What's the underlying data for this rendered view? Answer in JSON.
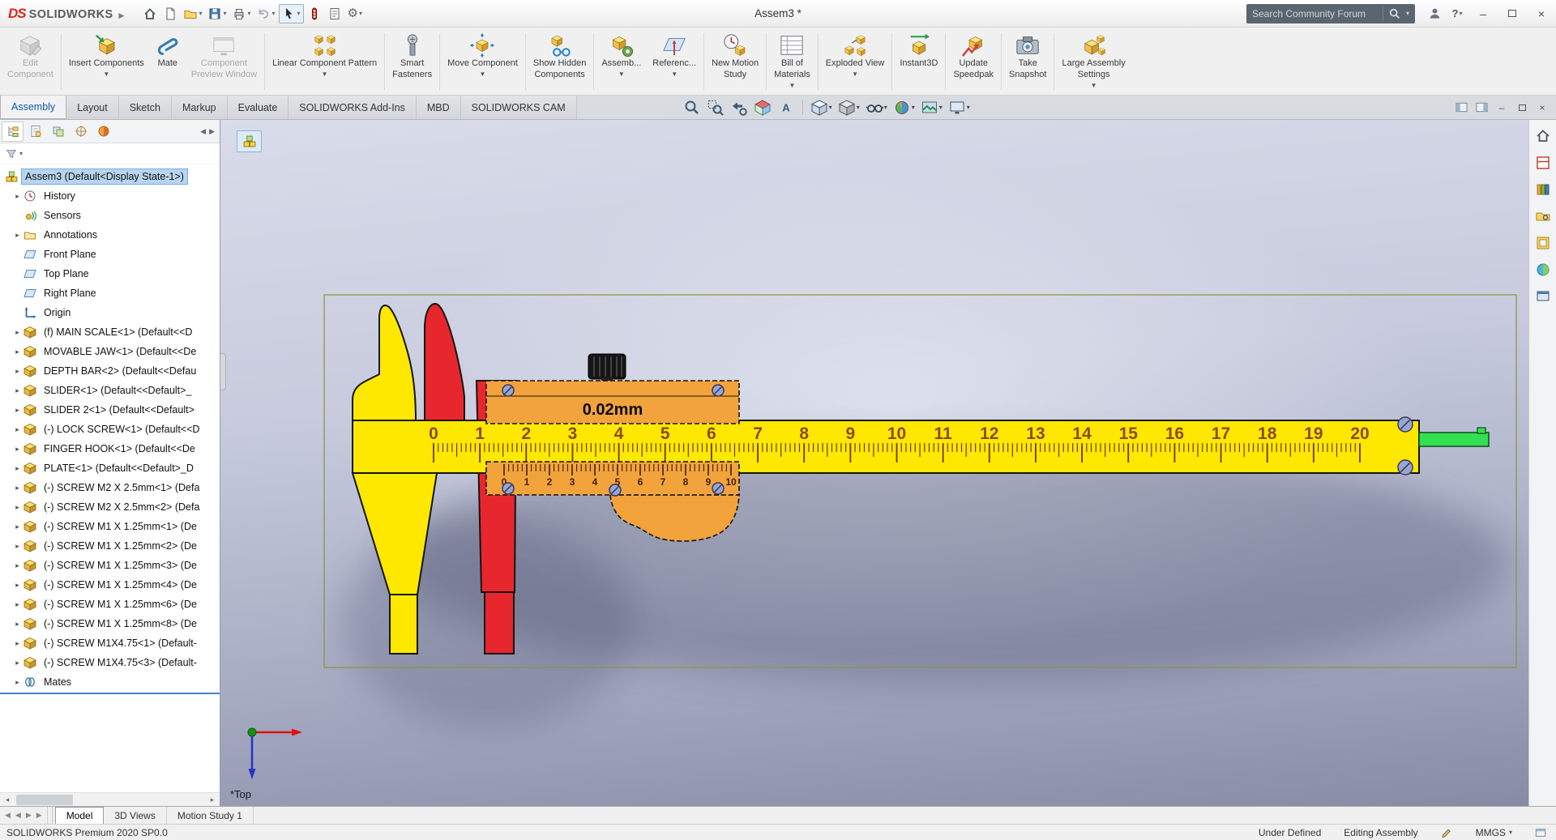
{
  "titlebar": {
    "brand_ds": "DS",
    "brand": "SOLIDWORKS",
    "title": "Assem3 *",
    "search_placeholder": "Search Community Forum",
    "help_label": "?",
    "qat": [
      {
        "name": "home"
      },
      {
        "name": "new-document"
      },
      {
        "name": "open",
        "arrow": true
      },
      {
        "name": "save",
        "arrow": true
      },
      {
        "name": "print",
        "arrow": true
      },
      {
        "name": "undo",
        "arrow": true
      },
      {
        "name": "select",
        "arrow": true
      },
      {
        "name": "rebuild"
      },
      {
        "name": "file-properties"
      },
      {
        "name": "options",
        "arrow": true
      }
    ]
  },
  "ribbon": {
    "buttons": [
      {
        "label": "Edit",
        "label2": "Component",
        "icon": "editcomp",
        "disabled": true,
        "sep_after": true
      },
      {
        "label": "Insert Components",
        "icon": "insert",
        "arrow": true
      },
      {
        "label": "Mate",
        "icon": "mate"
      },
      {
        "label": "Component",
        "label2": "Preview Window",
        "icon": "preview",
        "disabled": true,
        "sep_after": true
      },
      {
        "label": "Linear Component Pattern",
        "icon": "pattern",
        "arrow": true,
        "sep_after": true
      },
      {
        "label": "Smart",
        "label2": "Fasteners",
        "icon": "fastener",
        "sep_after": true
      },
      {
        "label": "Move Component",
        "icon": "move",
        "arrow": true,
        "sep_after": true
      },
      {
        "label": "Show Hidden",
        "label2": "Components",
        "icon": "showhidden",
        "sep_after": true
      },
      {
        "label": "Assemb...",
        "icon": "feature",
        "arrow": true
      },
      {
        "label": "Referenc...",
        "icon": "refgeo",
        "arrow": true,
        "sep_after": true
      },
      {
        "label": "New Motion",
        "label2": "Study",
        "icon": "motion",
        "sep_after": true
      },
      {
        "label": "Bill of",
        "label2": "Materials",
        "icon": "bom",
        "arrow": true,
        "sep_after": true
      },
      {
        "label": "Exploded View",
        "icon": "explode",
        "arrow": true,
        "sep_after": true
      },
      {
        "label": "Instant3D",
        "icon": "instant3d",
        "sep_after": true
      },
      {
        "label": "Update",
        "label2": "Speedpak",
        "icon": "speedpak",
        "sep_after": true
      },
      {
        "label": "Take",
        "label2": "Snapshot",
        "icon": "snapshot",
        "sep_after": true
      },
      {
        "label": "Large Assembly",
        "label2": "Settings",
        "icon": "largeasm",
        "arrow": true
      }
    ]
  },
  "command_tabs": [
    {
      "label": "Assembly",
      "active": true
    },
    {
      "label": "Layout"
    },
    {
      "label": "Sketch"
    },
    {
      "label": "Markup"
    },
    {
      "label": "Evaluate"
    },
    {
      "label": "SOLIDWORKS Add-Ins"
    },
    {
      "label": "MBD"
    },
    {
      "label": "SOLIDWORKS CAM"
    }
  ],
  "hud": [
    {
      "name": "zoom-to-fit"
    },
    {
      "name": "zoom-to-area"
    },
    {
      "name": "previous-view"
    },
    {
      "name": "section-view"
    },
    {
      "name": "dynamic-annotation-views",
      "sep_after": true
    },
    {
      "name": "view-orientation",
      "arrow": true
    },
    {
      "name": "display-style",
      "arrow": true
    },
    {
      "name": "hide-show-items",
      "arrow": true
    },
    {
      "name": "edit-appearance",
      "arrow": true
    },
    {
      "name": "apply-scene",
      "arrow": true
    },
    {
      "name": "view-settings",
      "arrow": true
    }
  ],
  "feature_tree": {
    "panel_tabs": [
      "featuremanager-design-tree",
      "propertymanager",
      "configurationmanager",
      "dimxpertmanager",
      "displaymanager"
    ],
    "items": [
      {
        "label": "Assem3  (Default<Display State-1>)",
        "icon": "assembly",
        "root": true,
        "selected": true
      },
      {
        "label": "History",
        "icon": "history",
        "arrow": true
      },
      {
        "label": "Sensors",
        "icon": "sensors"
      },
      {
        "label": "Annotations",
        "icon": "annotations",
        "arrow": true
      },
      {
        "label": "Front Plane",
        "icon": "plane"
      },
      {
        "label": "Top Plane",
        "icon": "plane"
      },
      {
        "label": "Right Plane",
        "icon": "plane"
      },
      {
        "label": "Origin",
        "icon": "origin"
      },
      {
        "label": "(f) MAIN SCALE<1> (Default<<D",
        "icon": "part",
        "arrow": true
      },
      {
        "label": "MOVABLE JAW<1> (Default<<De",
        "icon": "part",
        "arrow": true
      },
      {
        "label": "DEPTH BAR<2> (Default<<Defau",
        "icon": "part",
        "arrow": true
      },
      {
        "label": "SLIDER<1> (Default<<Default>_",
        "icon": "part",
        "arrow": true
      },
      {
        "label": "SLIDER 2<1> (Default<<Default>",
        "icon": "part",
        "arrow": true
      },
      {
        "label": "(-) LOCK SCREW<1> (Default<<D",
        "icon": "part",
        "arrow": true
      },
      {
        "label": "FINGER HOOK<1> (Default<<De",
        "icon": "part",
        "arrow": true
      },
      {
        "label": "PLATE<1> (Default<<Default>_D",
        "icon": "part",
        "arrow": true
      },
      {
        "label": "(-) SCREW M2 X 2.5mm<1> (Defa",
        "icon": "part",
        "arrow": true
      },
      {
        "label": "(-) SCREW M2 X 2.5mm<2> (Defa",
        "icon": "part",
        "arrow": true
      },
      {
        "label": "(-) SCREW M1 X 1.25mm<1> (De",
        "icon": "part",
        "arrow": true
      },
      {
        "label": "(-) SCREW M1 X 1.25mm<2> (De",
        "icon": "part",
        "arrow": true
      },
      {
        "label": "(-) SCREW M1 X 1.25mm<3> (De",
        "icon": "part",
        "arrow": true
      },
      {
        "label": "(-) SCREW M1 X 1.25mm<4> (De",
        "icon": "part",
        "arrow": true
      },
      {
        "label": "(-) SCREW M1 X 1.25mm<6> (De",
        "icon": "part",
        "arrow": true
      },
      {
        "label": "(-) SCREW M1 X 1.25mm<8> (De",
        "icon": "part",
        "arrow": true
      },
      {
        "label": "(-) SCREW M1X4.75<1> (Default-",
        "icon": "part",
        "arrow": true
      },
      {
        "label": "(-) SCREW M1X4.75<3> (Default-",
        "icon": "part",
        "arrow": true
      },
      {
        "label": "Mates",
        "icon": "mates",
        "arrow": true
      }
    ]
  },
  "viewport": {
    "orientation_label": "*Top",
    "caliper": {
      "precision_label": "0.02mm",
      "main_scale": {
        "min": 0,
        "max": 20
      },
      "vernier_scale": {
        "min": 0,
        "max": 10
      },
      "colors": {
        "beam": "#ffe800",
        "jaw": "#e8262e",
        "slider": "#f2a33c",
        "depth_bar": "#35df52",
        "screw": "#98a6d5"
      }
    }
  },
  "taskpane": [
    {
      "name": "home"
    },
    {
      "name": "solidworks-resources"
    },
    {
      "name": "design-library"
    },
    {
      "name": "file-explorer"
    },
    {
      "name": "view-palette"
    },
    {
      "name": "appearances-scenes"
    },
    {
      "name": "custom-properties"
    }
  ],
  "bottom_tabs": [
    {
      "label": "Model",
      "active": true
    },
    {
      "label": "3D Views"
    },
    {
      "label": "Motion Study 1"
    }
  ],
  "statusbar": {
    "left": "SOLIDWORKS Premium 2020 SP0.0",
    "state": "Under Defined",
    "mode": "Editing Assembly",
    "units": "MMGS"
  }
}
